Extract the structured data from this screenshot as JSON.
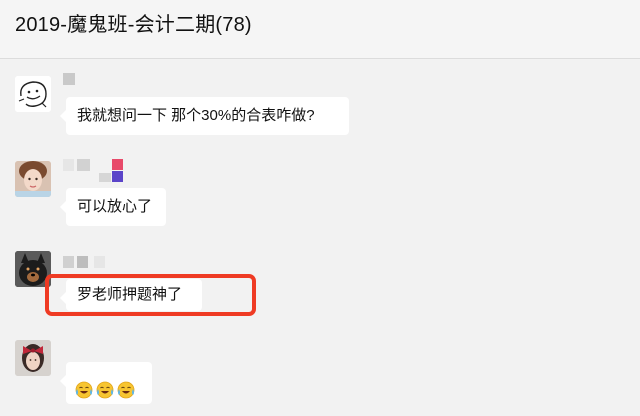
{
  "chat": {
    "title": "2019-魔鬼班-会计二期(78)"
  },
  "messages": [
    {
      "text": "我就想问一下 那个30%的合表咋做?"
    },
    {
      "text": "可以放心了"
    },
    {
      "text": "罗老师押题神了"
    },
    {
      "emojis": [
        "laughing-crying-emoji",
        "laughing-crying-emoji",
        "laughing-crying-emoji"
      ]
    }
  ],
  "colors": {
    "highlight": "#ef3b24",
    "bubble": "#ffffff",
    "background": "#f2f2f2"
  }
}
